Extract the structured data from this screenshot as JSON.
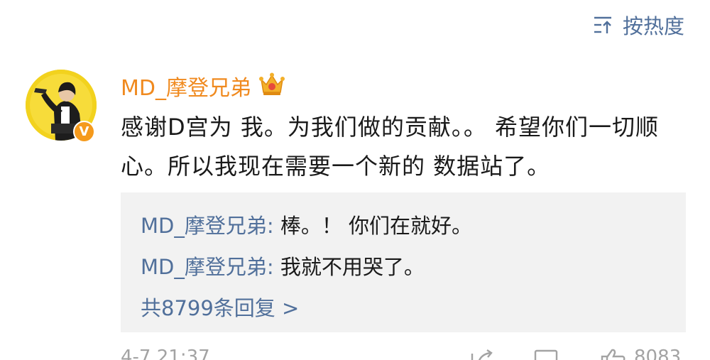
{
  "sort": {
    "label": "按热度",
    "icon": "sort-lines-icon"
  },
  "comment": {
    "author": "MD_摩登兄弟",
    "author_color": "#f08a1f",
    "badge_icon": "crown-icon",
    "verified_label": "V",
    "verified_color": "#f59a1c",
    "text": "感谢D宫为 我。为我们做的贡献。。 希望你们一切顺心。所以我现在需要一个新的 数据站了。"
  },
  "replies": [
    {
      "author": "MD_摩登兄弟:",
      "text": " 棒。！ 你们在就好。"
    },
    {
      "author": "MD_摩登兄弟:",
      "text": " 我就不用哭了。"
    }
  ],
  "reply_more": "共8799条回复 >",
  "link_color": "#51709b",
  "footer": {
    "time": "4-7 21:37",
    "share_icon": "share-icon",
    "comment_icon": "comment-icon",
    "like_icon": "thumbs-up-icon",
    "like_count": "8083"
  }
}
